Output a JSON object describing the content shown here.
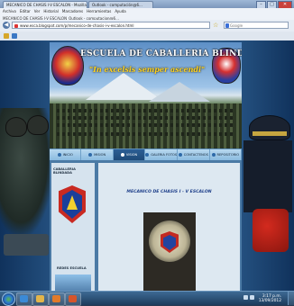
{
  "browser": {
    "tab_title": "MECANICO DE CHASIS I-V ESCALON - Mozilla Firefox",
    "tab2_title": "Outlook - computación@6...",
    "menu": [
      "Archivo",
      "Editar",
      "Ver",
      "Historial",
      "Marcadores",
      "Herramientas",
      "Ayuda"
    ],
    "menu_tabs": [
      "MECANICO DE CHASIS I-V ESCALON",
      "Outlook - computacion@6..."
    ],
    "url": "www.esca.blogspot.com/p/mecanico-de-chasis-i-v-escalon.html",
    "search_placeholder": "Google"
  },
  "site": {
    "title": "ESCUELA DE CABALLERIA BLINDADA",
    "motto": "\"In excelsis semper ascendi\"",
    "nav": [
      "INICIO",
      "MISION",
      "VISION",
      "GALERIA FOTOS",
      "CONTACTENOS",
      "REPOSITORIO"
    ],
    "nav_active_index": 2,
    "sidebar_title": "CABALLERIA BLINDADA",
    "sidebar_title2": "REDES ESCUELA",
    "main_title": "MECANICO DE CHASIS I - V ESCALON"
  },
  "taskbar": {
    "time": "3:17 p.m.",
    "date": "13/09/2012"
  },
  "colors": {
    "accent": "#2c5f95",
    "motto": "#ffd21c",
    "title_blue": "#1e3f8a"
  }
}
